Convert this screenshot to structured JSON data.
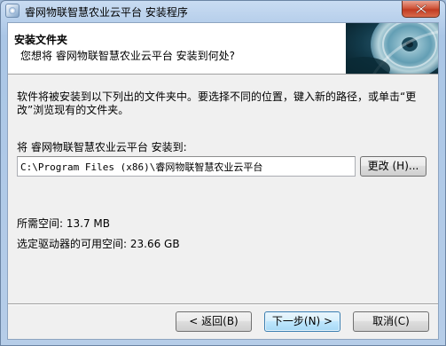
{
  "window": {
    "title": "睿网物联智慧农业云平台 安装程序"
  },
  "header": {
    "title": "安装文件夹",
    "subtitle": "您想将 睿网物联智慧农业云平台 安装到何处?"
  },
  "body": {
    "description": "软件将被安装到以下列出的文件夹中。要选择不同的位置，键入新的路径，或单击“更改”浏览现有的文件夹。",
    "destination_label": "将 睿网物联智慧农业云平台 安装到:",
    "destination_path": "C:\\Program Files (x86)\\睿网物联智慧农业云平台",
    "browse_label": "更改 (H)...",
    "space_required": "所需空间: 13.7 MB",
    "space_available": "选定驱动器的可用空间: 23.66 GB"
  },
  "footer": {
    "back_label": "< 返回(B)",
    "next_label": "下一步(N) >",
    "cancel_label": "取消(C)"
  },
  "icons": {
    "app": "installer-icon",
    "close": "close-icon",
    "banner": "cd-disc-graphic"
  },
  "colors": {
    "close_button": "#c13b22",
    "default_button_border": "#3c7fb1"
  }
}
